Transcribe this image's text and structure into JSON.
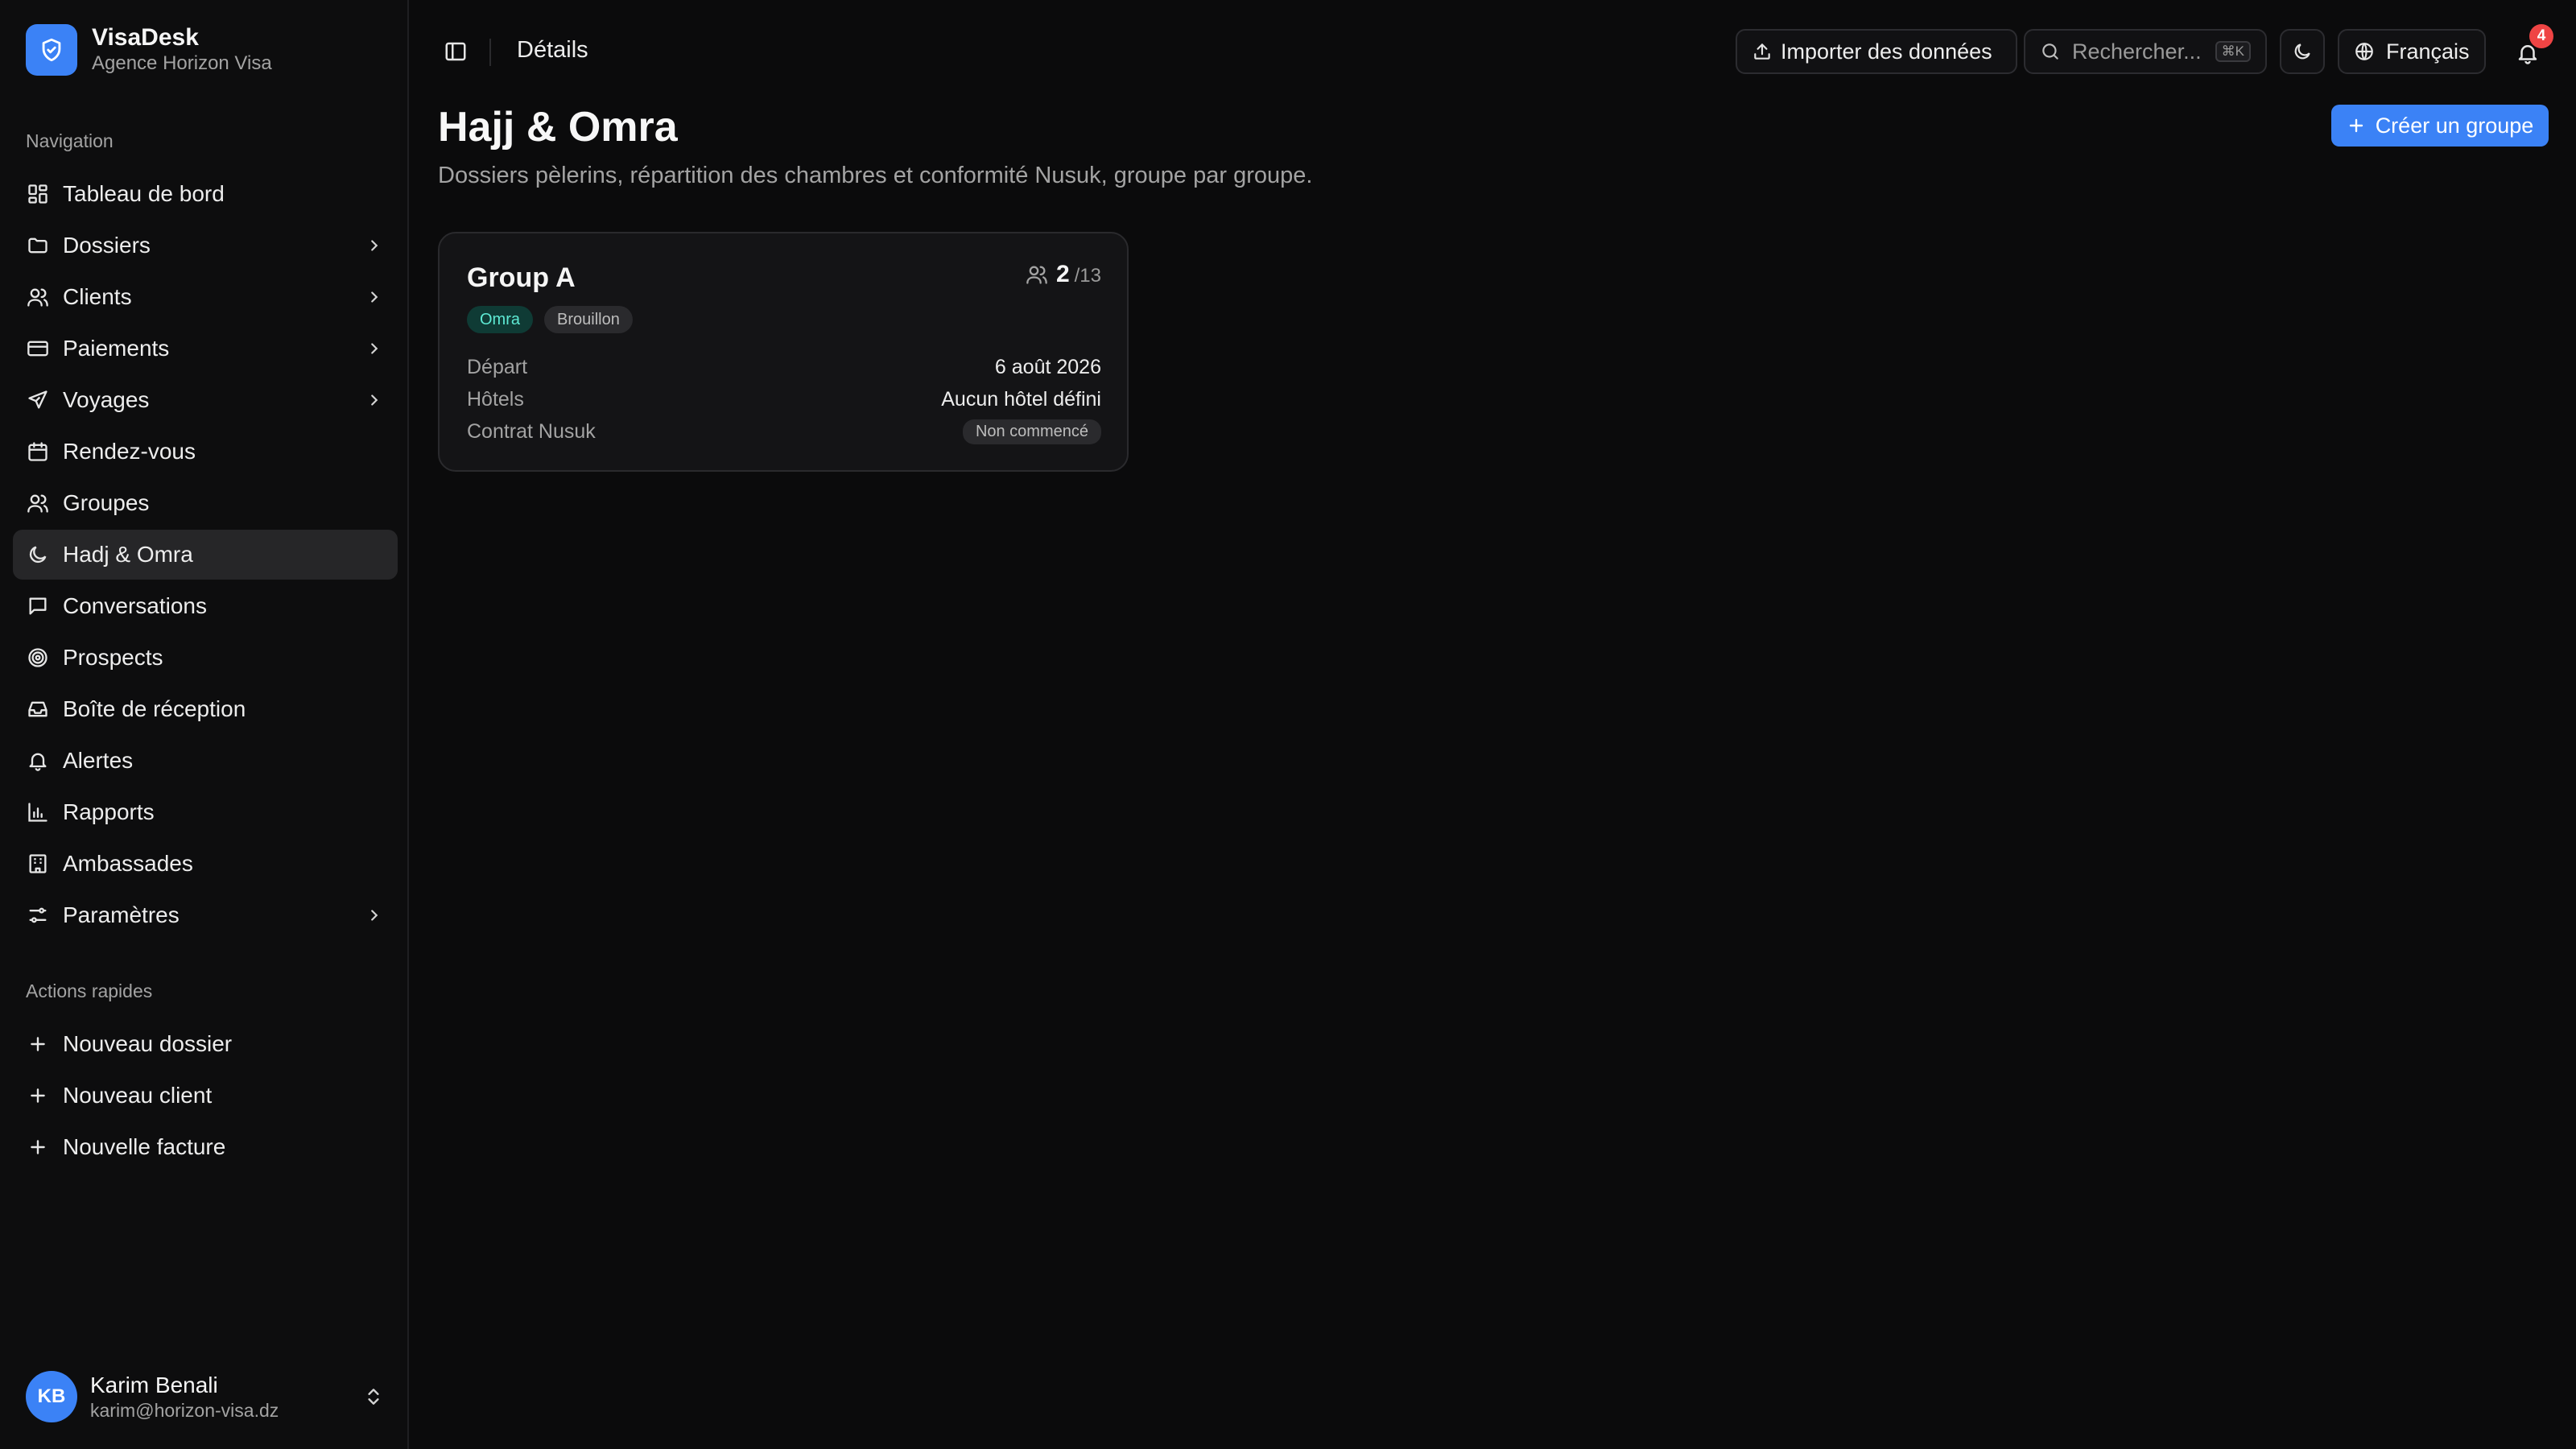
{
  "brand": {
    "name": "VisaDesk",
    "subtitle": "Agence Horizon Visa",
    "logo_icon": "shield-icon",
    "accent": "#3b82f6"
  },
  "sidebar": {
    "nav_label": "Navigation",
    "items": [
      {
        "label": "Tableau de bord",
        "icon": "dashboard-icon",
        "has_children": false
      },
      {
        "label": "Dossiers",
        "icon": "folder-icon",
        "has_children": true
      },
      {
        "label": "Clients",
        "icon": "users-icon",
        "has_children": true
      },
      {
        "label": "Paiements",
        "icon": "credit-card-icon",
        "has_children": true
      },
      {
        "label": "Voyages",
        "icon": "plane-icon",
        "has_children": true
      },
      {
        "label": "Rendez-vous",
        "icon": "calendar-icon",
        "has_children": false
      },
      {
        "label": "Groupes",
        "icon": "group-icon",
        "has_children": false
      },
      {
        "label": "Hadj & Omra",
        "icon": "crescent-icon",
        "has_children": false,
        "active": true
      },
      {
        "label": "Conversations",
        "icon": "message-icon",
        "has_children": false
      },
      {
        "label": "Prospects",
        "icon": "target-icon",
        "has_children": false
      },
      {
        "label": "Boîte de réception",
        "icon": "inbox-icon",
        "has_children": false
      },
      {
        "label": "Alertes",
        "icon": "bell-icon",
        "has_children": false
      },
      {
        "label": "Rapports",
        "icon": "bar-chart-icon",
        "has_children": false
      },
      {
        "label": "Ambassades",
        "icon": "building-icon",
        "has_children": false
      },
      {
        "label": "Paramètres",
        "icon": "settings-icon",
        "has_children": true
      }
    ],
    "quick_label": "Actions rapides",
    "quick": [
      {
        "label": "Nouveau dossier",
        "icon": "plus-icon"
      },
      {
        "label": "Nouveau client",
        "icon": "plus-icon"
      },
      {
        "label": "Nouvelle facture",
        "icon": "plus-icon"
      }
    ],
    "user": {
      "initials": "KB",
      "name": "Karim Benali",
      "email": "karim@horizon-visa.dz"
    }
  },
  "topbar": {
    "breadcrumb": "Détails",
    "import_label": "Importer des données",
    "search_placeholder": "Rechercher...",
    "search_shortcut": "⌘K",
    "language": "Français",
    "notification_count": "4"
  },
  "main": {
    "title": "Hajj & Omra",
    "subtitle": "Dossiers pèlerins, répartition des chambres et conformité Nusuk, groupe par groupe.",
    "create_label": "Créer un groupe",
    "groups": [
      {
        "name": "Group A",
        "count": "2",
        "capacity": "/13",
        "tags": [
          "Omra",
          "Brouillon"
        ],
        "rows": [
          {
            "label": "Départ",
            "value": "6 août 2026"
          },
          {
            "label": "Hôtels",
            "value": "Aucun hôtel défini"
          },
          {
            "label": "Contrat Nusuk",
            "value": "Non commencé"
          }
        ]
      }
    ]
  }
}
